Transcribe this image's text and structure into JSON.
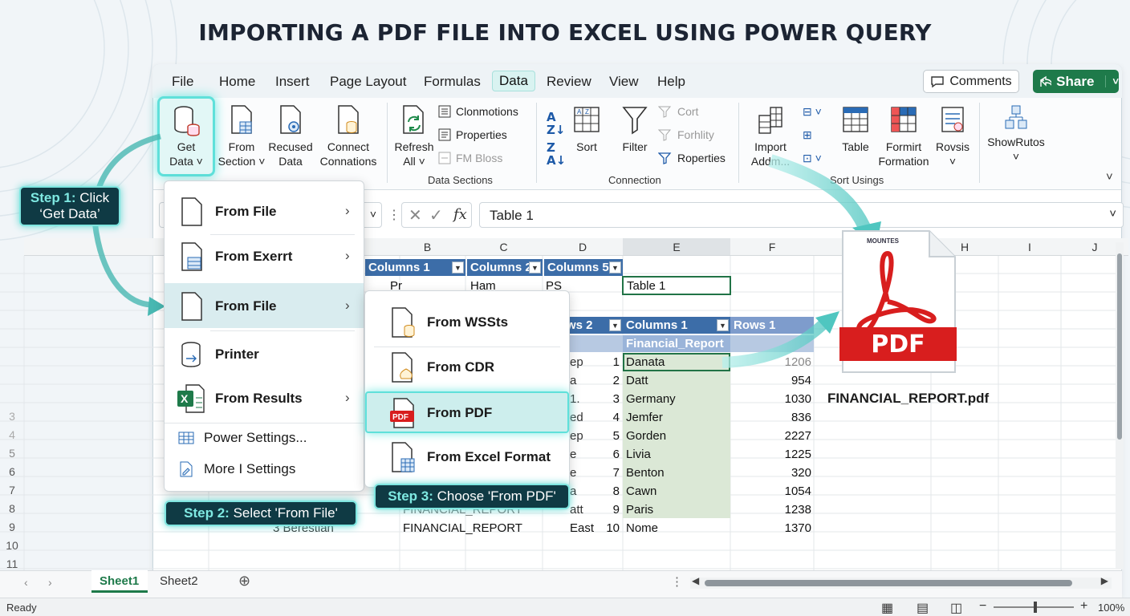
{
  "title": "IMPORTING A PDF FILE INTO EXCEL USING POWER QUERY",
  "tabs": [
    "File",
    "Home",
    "Insert",
    "Page Layout",
    "Formulas",
    "Data",
    "Review",
    "View",
    "Help"
  ],
  "active_tab": "Data",
  "comments_label": "Comments",
  "share_label": "Share",
  "ribbon": {
    "get_data": [
      "Get",
      "Data ˅"
    ],
    "from_section": [
      "From",
      "Section ˅"
    ],
    "recused_data": [
      "Recused",
      "Data"
    ],
    "connect_connations": [
      "Connect",
      "Connations"
    ],
    "refresh_all": [
      "Refresh",
      "All ˅"
    ],
    "clonmotions": "Clonmotions",
    "properties": "Properties",
    "fm_bloss": "FM Bloss",
    "sort": "Sort",
    "filter": "Filter",
    "cort": "Cort",
    "forhlity": "Forhlity",
    "roperties": "Roperties",
    "import": [
      "Import",
      "Addm..."
    ],
    "table": "Table",
    "formit": [
      "Formirt",
      "Formation"
    ],
    "rovsis": "Rovsis",
    "showrutos": "ShowRutos",
    "group_data_sections": "Data Sections",
    "group_connection": "Connection",
    "group_sort_usings": "Sort Usings",
    "group_get_data": "Get Data"
  },
  "formula": {
    "fx": "fx",
    "value": "Table 1"
  },
  "columns": [
    "B",
    "C",
    "D",
    "E",
    "F",
    "H",
    "I",
    "J"
  ],
  "row_numbers": [
    "3",
    "4",
    "5",
    "6",
    "7",
    "8",
    "9",
    "10",
    "11"
  ],
  "table1": {
    "headers": [
      "Columns 1",
      "Columns 2",
      "Columns 5"
    ],
    "row": [
      "Pr",
      "Ham",
      "PS"
    ],
    "name_cell": "Table 1"
  },
  "table2": {
    "headers": [
      "ws 2",
      "Columns 1",
      "Rows 1"
    ],
    "subheader": "Financial_Report",
    "rows": [
      {
        "d": "ep",
        "n": "1",
        "name": "Danata",
        "val": "1206"
      },
      {
        "d": "a",
        "n": "2",
        "name": "Datt",
        "val": "954"
      },
      {
        "d": "1.",
        "n": "3",
        "name": "Germany",
        "val": "1030"
      },
      {
        "d": "ed",
        "n": "4",
        "name": "Jemfer",
        "val": "836"
      },
      {
        "d": "ep",
        "n": "5",
        "name": "Gorden",
        "val": "2227"
      },
      {
        "d": "e",
        "n": "6",
        "name": "Livia",
        "val": "1225"
      },
      {
        "d": "e",
        "n": "7",
        "name": "Benton",
        "val": "320"
      },
      {
        "d": "a",
        "n": "8",
        "name": "Cawn",
        "val": "1054"
      },
      {
        "d": "att",
        "n": "9",
        "name": "Paris",
        "val": "1238"
      },
      {
        "d": "East",
        "n": "10",
        "name": "Nome",
        "val": "1370"
      }
    ],
    "row9_prefix": "3 Berestian",
    "row9_col_c": "FINANCIAL_REPORT",
    "row8_col_c": "FINANCIAL_REPORT"
  },
  "menu1": [
    {
      "label": "From File",
      "icon": "file-icon",
      "arrow": true
    },
    {
      "label": "From Exerrt",
      "icon": "file-table-icon",
      "arrow": true
    },
    {
      "label": "From File",
      "icon": "file-icon",
      "arrow": true
    },
    {
      "label": "Printer",
      "icon": "database-icon",
      "arrow": false
    },
    {
      "label": "From Results",
      "icon": "excel-icon",
      "arrow": true
    }
  ],
  "menu1_small": [
    "Power Settings...",
    "More I Settings"
  ],
  "menu2": [
    {
      "label": "From WSSts",
      "icon": "file-db-icon"
    },
    {
      "label": "From CDR",
      "icon": "file-cdr-icon"
    },
    {
      "label": "From PDF",
      "icon": "pdf-icon"
    },
    {
      "label": "From Excel Format",
      "icon": "file-grid-icon"
    }
  ],
  "callouts": {
    "step1": {
      "bold": "Step 1:",
      "text": "Click ‘Get Data’"
    },
    "step2": {
      "bold": "Step 2:",
      "text": "Select 'From File'"
    },
    "step3": {
      "bold": "Step 3:",
      "text": "Choose 'From PDF'"
    }
  },
  "pdf": {
    "badge": "PDF",
    "logo_text": "MOUNTES",
    "filename": "FINANCIAL_REPORT.pdf"
  },
  "sheets": [
    "Sheet1",
    "Sheet2"
  ],
  "status": {
    "ready": "Ready",
    "zoom": "100%"
  },
  "colors": {
    "accent": "#1e7a4a",
    "teal": "#5fe0da",
    "table_header": "#3c6da8",
    "pdf_red": "#d81e1e"
  }
}
